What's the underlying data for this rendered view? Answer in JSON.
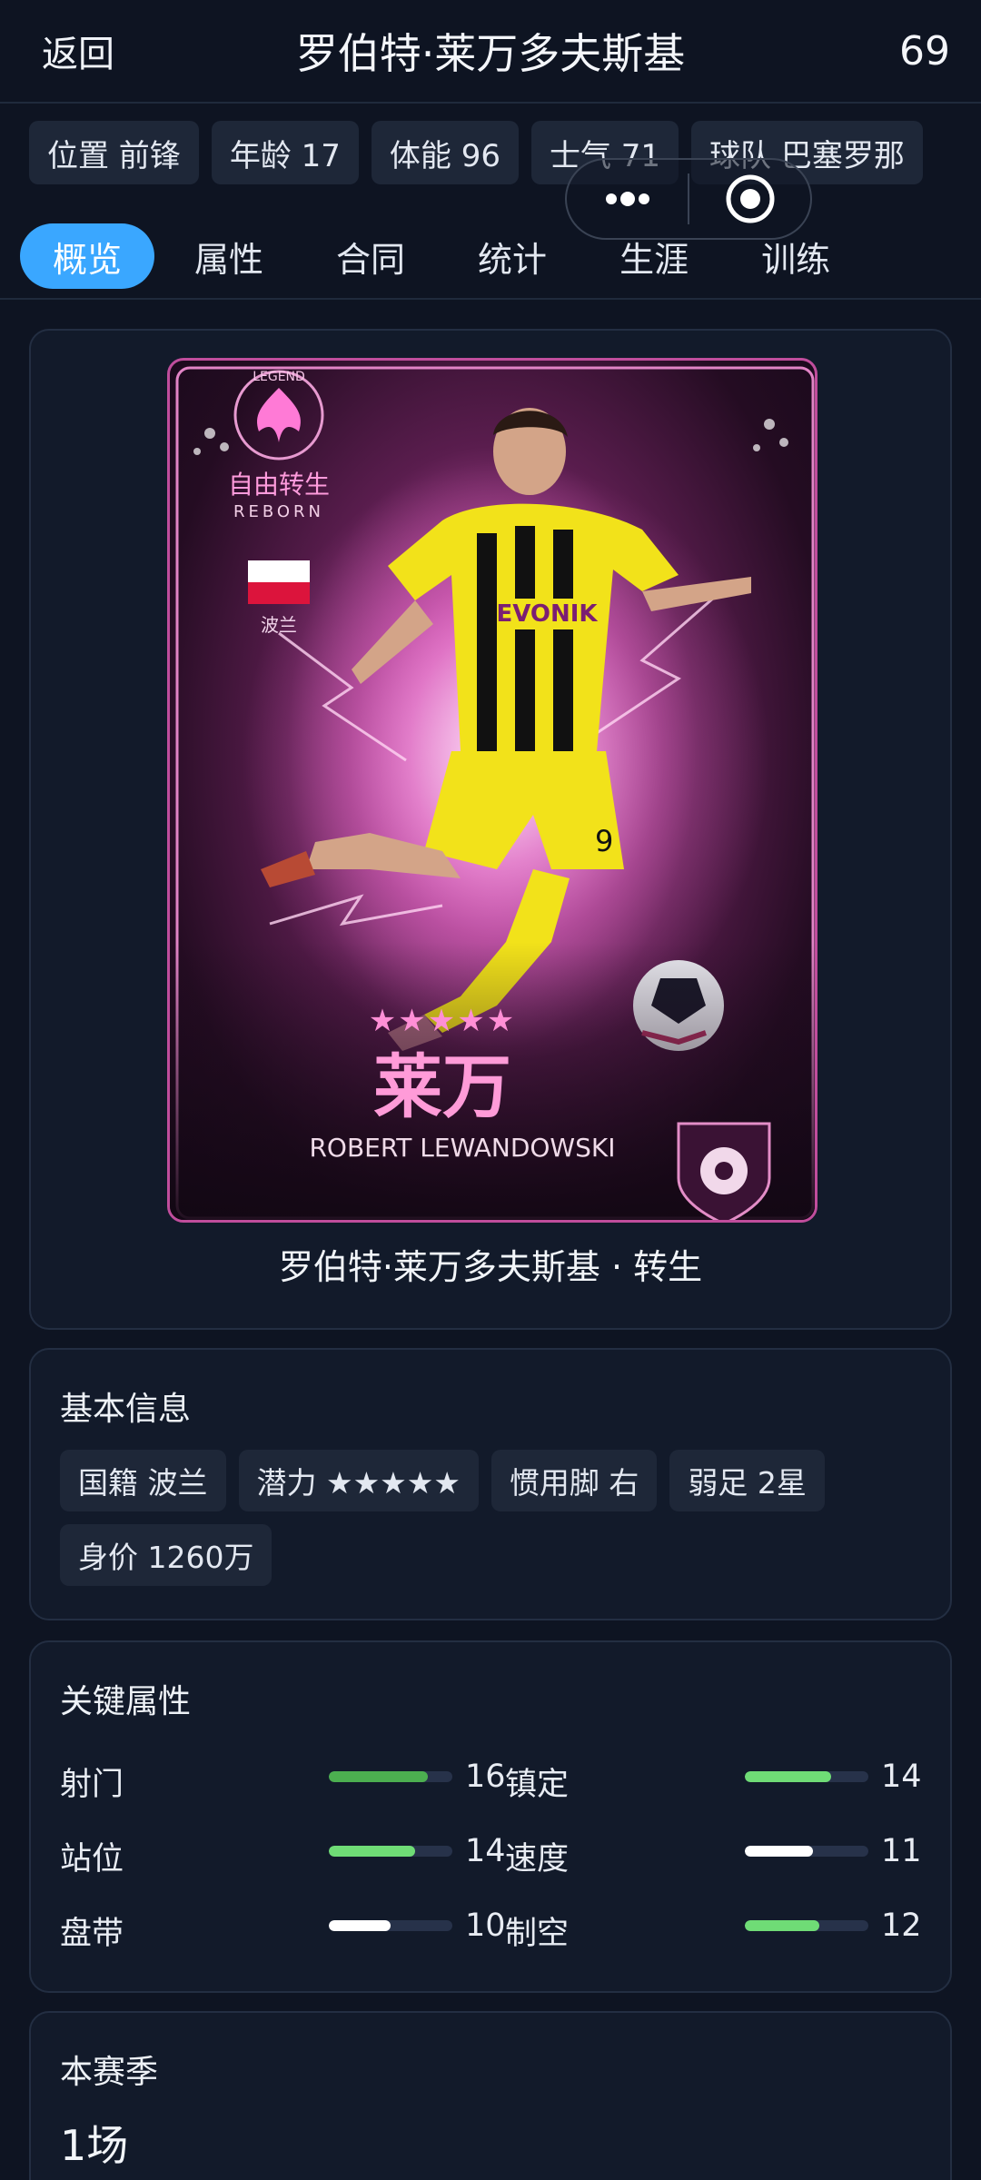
{
  "header": {
    "back_label": "返回",
    "title": "罗伯特·莱万多夫斯基",
    "rating": "69"
  },
  "chips": [
    "位置 前锋",
    "年龄 17",
    "体能 96",
    "士气 71",
    "球队 巴塞罗那"
  ],
  "tabs": [
    "概览",
    "属性",
    "合同",
    "统计",
    "生涯",
    "训练"
  ],
  "card": {
    "badge_top": "LEGEND",
    "badge_cn": "自由转生",
    "badge_en": "REBORN",
    "country": "波兰",
    "stars": "★★★★★",
    "short_name": "莱万",
    "full_name_en": "ROBERT LEWANDOWSKI",
    "jersey_sponsor": "EVONIK",
    "jersey_number": "9",
    "caption": "罗伯特·莱万多夫斯基 · 转生"
  },
  "basic_info": {
    "title": "基本信息",
    "chips": [
      "国籍 波兰",
      "潜力 ★★★★★",
      "惯用脚 右",
      "弱足 2星",
      "身价 1260万"
    ]
  },
  "key_attrs": {
    "title": "关键属性",
    "rows": [
      {
        "left": {
          "name": "射门",
          "value": "16",
          "level": 0.8,
          "color": "#4caf50"
        },
        "right": {
          "name": "镇定",
          "value": "14",
          "level": 0.7,
          "color": "#6fdc76"
        }
      },
      {
        "left": {
          "name": "站位",
          "value": "14",
          "level": 0.7,
          "color": "#6fdc76"
        },
        "right": {
          "name": "速度",
          "value": "11",
          "level": 0.55,
          "color": "#ffffff"
        }
      },
      {
        "left": {
          "name": "盘带",
          "value": "10",
          "level": 0.5,
          "color": "#ffffff"
        },
        "right": {
          "name": "制空",
          "value": "12",
          "level": 0.6,
          "color": "#6fdc76"
        }
      }
    ]
  },
  "season": {
    "title": "本赛季",
    "matches": "1场"
  },
  "colors": {
    "accent": "#3aa7ff",
    "background": "#0e1422",
    "card": "#121a2a"
  },
  "icons": [
    "more-dots-icon",
    "target-icon",
    "poland-flag-icon",
    "phoenix-badge-icon",
    "club-shield-icon"
  ]
}
